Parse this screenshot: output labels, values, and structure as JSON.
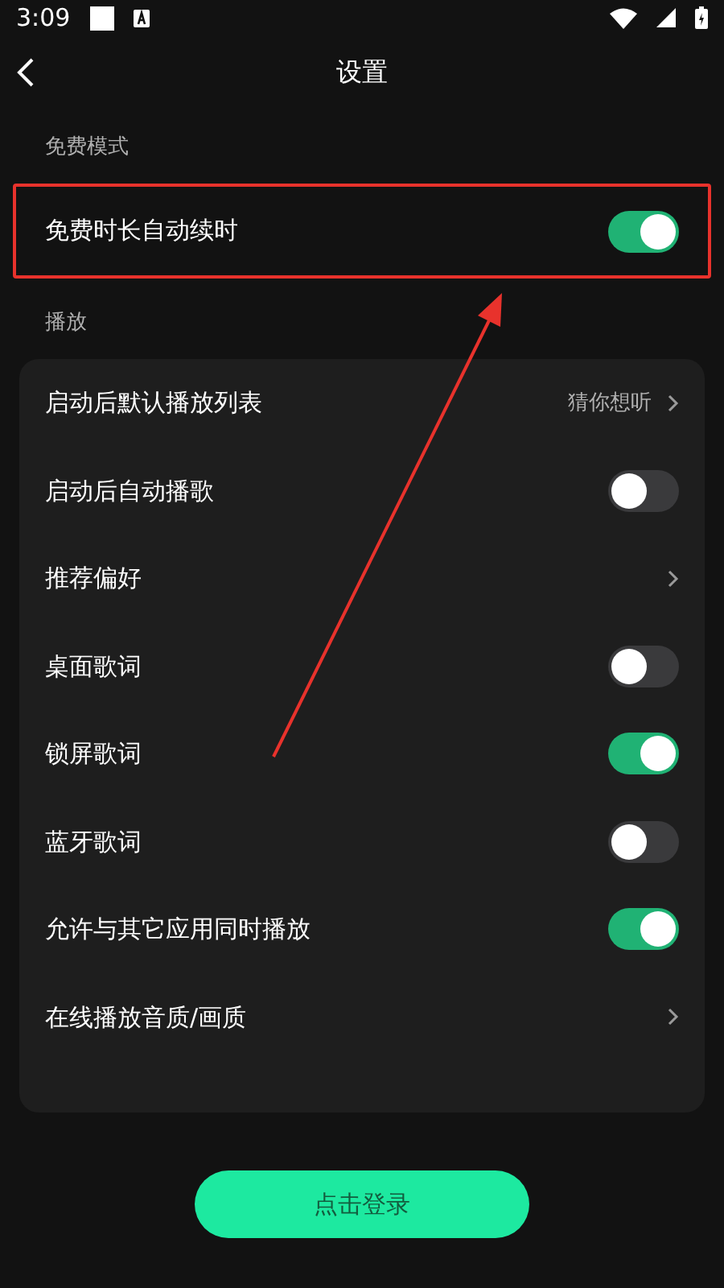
{
  "status_bar": {
    "time": "3:09"
  },
  "header": {
    "title": "设置"
  },
  "sections": [
    {
      "label": "免费模式",
      "carded": false,
      "rows": [
        {
          "kind": "toggle",
          "label": "免费时长自动续时",
          "on": true
        }
      ]
    },
    {
      "label": "播放",
      "carded": true,
      "rows": [
        {
          "kind": "link",
          "label": "启动后默认播放列表",
          "value": "猜你想听"
        },
        {
          "kind": "toggle",
          "label": "启动后自动播歌",
          "on": false
        },
        {
          "kind": "link",
          "label": "推荐偏好"
        },
        {
          "kind": "toggle",
          "label": "桌面歌词",
          "on": false
        },
        {
          "kind": "toggle",
          "label": "锁屏歌词",
          "on": true
        },
        {
          "kind": "toggle",
          "label": "蓝牙歌词",
          "on": false
        },
        {
          "kind": "toggle",
          "label": "允许与其它应用同时播放",
          "on": true
        },
        {
          "kind": "link",
          "label": "在线播放音质/画质"
        }
      ]
    }
  ],
  "login_button": {
    "label": "点击登录"
  }
}
